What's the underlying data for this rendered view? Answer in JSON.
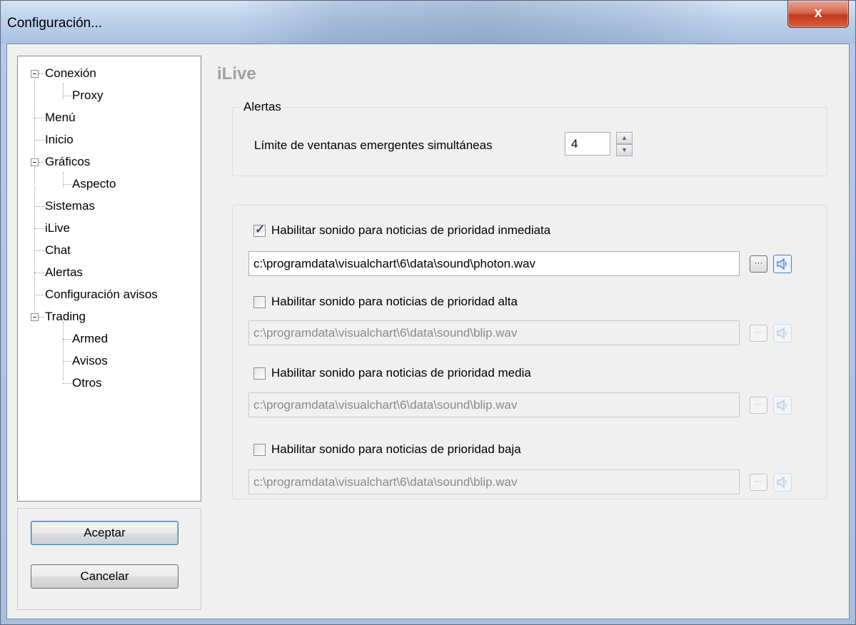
{
  "window": {
    "title": "Configuración...",
    "close_label": "x"
  },
  "tree": {
    "items": [
      {
        "label": "Conexión"
      },
      {
        "label": "Proxy"
      },
      {
        "label": "Menú"
      },
      {
        "label": "Inicio"
      },
      {
        "label": "Gráficos"
      },
      {
        "label": "Aspecto"
      },
      {
        "label": "Sistemas"
      },
      {
        "label": "iLive"
      },
      {
        "label": "Chat"
      },
      {
        "label": "Alertas"
      },
      {
        "label": "Configuración avisos"
      },
      {
        "label": "Trading"
      },
      {
        "label": "Armed"
      },
      {
        "label": "Avisos"
      },
      {
        "label": "Otros"
      }
    ]
  },
  "buttons": {
    "accept": "Aceptar",
    "cancel": "Cancelar"
  },
  "page": {
    "title": "iLive",
    "alerts_group": {
      "legend": "Alertas",
      "limit_label": "Límite de ventanas emergentes simultáneas",
      "limit_value": "4"
    },
    "sounds": [
      {
        "label": "Habilitar sonido para noticias de prioridad inmediata",
        "checked": true,
        "path": "c:\\programdata\\visualchart\\6\\data\\sound\\photon.wav"
      },
      {
        "label": "Habilitar sonido para noticias de prioridad alta",
        "checked": false,
        "path": "c:\\programdata\\visualchart\\6\\data\\sound\\blip.wav"
      },
      {
        "label": "Habilitar sonido para noticias de prioridad media",
        "checked": false,
        "path": "c:\\programdata\\visualchart\\6\\data\\sound\\blip.wav"
      },
      {
        "label": "Habilitar sonido para noticias de prioridad baja",
        "checked": false,
        "path": "c:\\programdata\\visualchart\\6\\data\\sound\\blip.wav"
      }
    ],
    "browse_label": "···"
  }
}
